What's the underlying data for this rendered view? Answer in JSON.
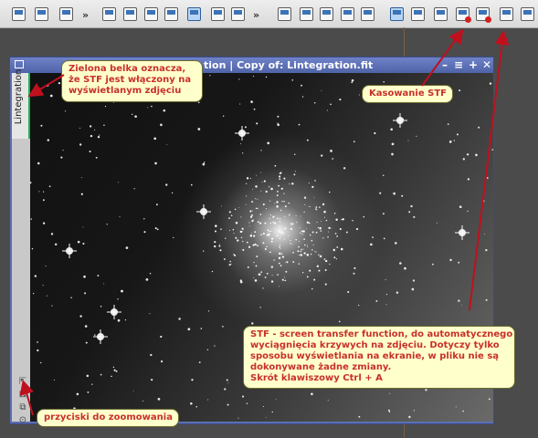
{
  "colors": {
    "green_bar": "#1db24c",
    "callout_text": "#c8302b",
    "callout_bg": "#ffffcc",
    "arrow": "#c0101e",
    "window_frame": "#5c6fb2"
  },
  "toolbar": {
    "buttons": [
      {
        "icon": "view-icon"
      },
      {
        "icon": "zoom-fit-icon"
      },
      {
        "icon": "window-icon"
      },
      {
        "icon": "preview-new-icon"
      },
      {
        "icon": "preview-edit-icon"
      },
      {
        "icon": "preview-dynamic-icon"
      },
      {
        "icon": "preview-delete-icon"
      },
      {
        "icon": "zoom-window-icon"
      },
      {
        "icon": "mask-icon"
      },
      {
        "icon": "mask-show-icon"
      },
      {
        "icon": "layout-icon"
      },
      {
        "icon": "layout-2-icon"
      },
      {
        "icon": "layout-3-icon"
      },
      {
        "icon": "layout-4-icon"
      },
      {
        "icon": "stf-display-icon"
      },
      {
        "icon": "stf-auto-icon"
      },
      {
        "icon": "stf-link-icon"
      },
      {
        "icon": "stf-reset-icon"
      },
      {
        "icon": "stf-delete-icon"
      },
      {
        "icon": "stf-settings-icon"
      },
      {
        "icon": "stf-options-icon"
      }
    ],
    "separator": "»"
  },
  "window": {
    "title": "tion | Copy of: Lintegration.fit",
    "side_tab_label": "Lintegration",
    "controls": [
      "–",
      "≡",
      "+",
      "✕"
    ],
    "zoom_buttons": [
      "⇱",
      "⊠",
      "⧉",
      "⊙"
    ]
  },
  "callouts": {
    "green_bar": [
      "Zielona belka oznacza,",
      "że STF jest włączony na",
      "wyświetlanym zdjęciu"
    ],
    "stf_reset": [
      "Kasowanie STF"
    ],
    "stf_description": [
      "STF - screen transfer function, do automatycznego",
      "wyciągnięcia krzywych na zdjęciu. Dotyczy tylko",
      "sposobu wyświetlania na ekranie, w pliku nie są",
      "dokonywane żadne zmiany.",
      "Skrót klawiszowy  Ctrl + A"
    ],
    "zoom_buttons": [
      "przyciski do zoomowania"
    ]
  }
}
